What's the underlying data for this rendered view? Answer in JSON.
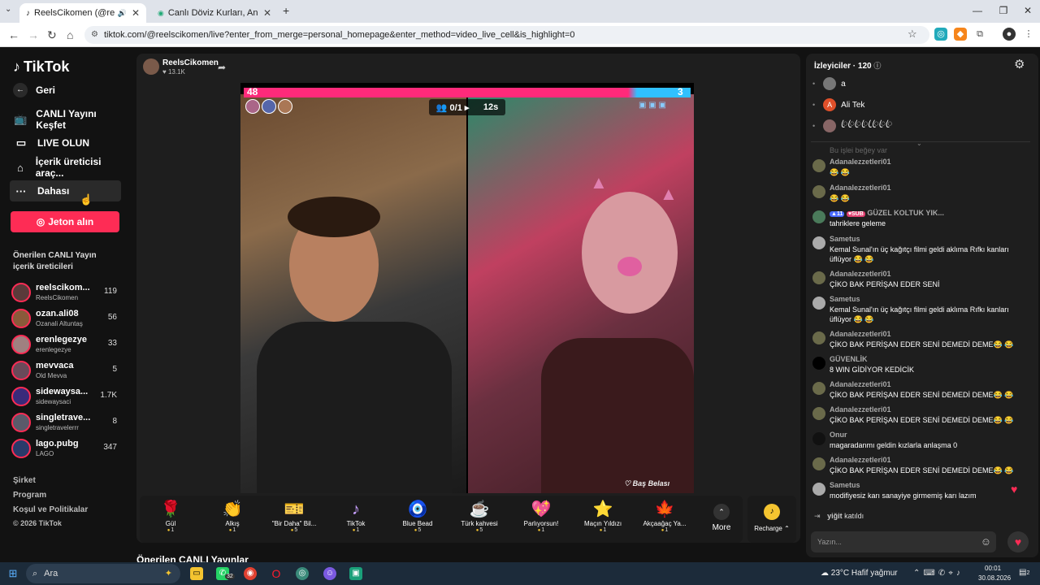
{
  "browser": {
    "tabs": [
      {
        "label": "ReelsCikomen (@reelscikom...",
        "active": true
      },
      {
        "label": "Canlı Döviz Kurları, Anlık Altın F...",
        "active": false
      }
    ],
    "url": "tiktok.com/@reelscikomen/live?enter_from_merge=personal_homepage&enter_method=video_live_cell&is_highlight=0"
  },
  "sidebar": {
    "logo": "TikTok",
    "back": "Geri",
    "nav": [
      {
        "label": "CANLI Yayını Keşfet",
        "icon": "live-tv-icon"
      },
      {
        "label": "LIVE OLUN",
        "icon": "camera-icon"
      },
      {
        "label": "İçerik üreticisi araç...",
        "icon": "home-tools-icon"
      },
      {
        "label": "Dahası",
        "icon": "more-icon"
      }
    ],
    "coins_button": "Jeton alın",
    "suggested_title": "Önerilen CANLI Yayın içerik üreticileri",
    "creators": [
      {
        "name": "reelscikom...",
        "sub": "ReelsCikomen",
        "count": "119"
      },
      {
        "name": "ozan.ali08",
        "sub": "Ozanali Altuntaş",
        "count": "56"
      },
      {
        "name": "erenlegezye",
        "sub": "erenlegezye",
        "count": "33"
      },
      {
        "name": "mevvaca",
        "sub": "Old Mevva",
        "count": "5"
      },
      {
        "name": "sidewaysa...",
        "sub": "sidewaysaci",
        "count": "1.7K"
      },
      {
        "name": "singletrave...",
        "sub": "singletravelerrr",
        "count": "8"
      },
      {
        "name": "lago.pubg",
        "sub": "LAGO",
        "count": "347"
      }
    ],
    "footer": [
      "Şirket",
      "Program",
      "Koşul ve Politikalar",
      "© 2026 TikTok"
    ]
  },
  "stream": {
    "host_name": "ReelsCikomen",
    "host_likes": "13.1K",
    "pk_left_score": "48",
    "pk_right_score": "3",
    "pk_count": "0/1",
    "pk_timer": "12s",
    "watermark": "Baş Belası",
    "suggested_live": "Önerilen CANLI Yayınlar"
  },
  "gifts": [
    {
      "name": "Gül",
      "price": "1",
      "icon": "🌹"
    },
    {
      "name": "Alkış",
      "price": "1",
      "icon": "👏"
    },
    {
      "name": "\"Bir Daha\" Bil...",
      "price": "5",
      "icon": "🎫"
    },
    {
      "name": "TikTok",
      "price": "1",
      "icon": "♪"
    },
    {
      "name": "Blue Bead",
      "price": "5",
      "icon": "🧿"
    },
    {
      "name": "Türk kahvesi",
      "price": "5",
      "icon": "☕"
    },
    {
      "name": "Parlıyorsun!",
      "price": "1",
      "icon": "💖"
    },
    {
      "name": "Maçın Yıldızı",
      "price": "1",
      "icon": "⭐"
    },
    {
      "name": "Akçaağaç Ya...",
      "price": "1",
      "icon": "🍁"
    }
  ],
  "gifts_more": "More",
  "recharge": "Recharge",
  "chat": {
    "viewers_title": "İzleyiciler · 120",
    "viewers": [
      {
        "name": "a",
        "initial": ""
      },
      {
        "name": "Ali Tek",
        "initial": "A"
      },
      {
        "name": "ꦿꦿꦿꦿ ꦿꦿꦿꦿ",
        "initial": ""
      }
    ],
    "faded_line": "Bu işlei beğey var",
    "messages": [
      {
        "user": "Adanalezzetleri01",
        "text": "😂 😂"
      },
      {
        "user": "Adanalezzetleri01",
        "text": "😂 😂"
      },
      {
        "user": "GÜZEL KOLTUK YIK...",
        "badge1": "11",
        "badge2": "SUB",
        "text": "tahriklere geleme"
      },
      {
        "user": "Sametus",
        "text": "Kemal Sunal'ın üç kağıtçı filmi geldi aklıma Rıfkı kanları üflüyor 😂 😂"
      },
      {
        "user": "Adanalezzetleri01",
        "text": "ÇİKO BAK PERİŞAN EDER SENİ"
      },
      {
        "user": "Sametus",
        "text": "Kemal Sunal'ın üç kağıtçı filmi geldi aklıma Rıfkı kanları üflüyor 😂 😂"
      },
      {
        "user": "Adanalezzetleri01",
        "text": "ÇİKO BAK PERİŞAN EDER SENİ DEMEDİ DEME😂 😂"
      },
      {
        "user": "GÜVENLİK",
        "text": "8 WIN GİDİYOR KEDİCİK"
      },
      {
        "user": "Adanalezzetleri01",
        "text": "ÇİKO BAK PERİŞAN EDER SENİ DEMEDİ DEME😂 😂"
      },
      {
        "user": "Adanalezzetleri01",
        "text": "ÇİKO BAK PERİŞAN EDER SENİ DEMEDİ DEME😂 😂"
      },
      {
        "user": "Onur",
        "text": "magaradanmı geldin kızlarla anlaşma 0"
      },
      {
        "user": "Adanalezzetleri01",
        "text": "ÇİKO BAK PERİŞAN EDER SENİ DEMEDİ DEME😂 😂"
      },
      {
        "user": "Sametus",
        "text": "modifiyesiz karı sanayiye girmemiş karı lazım"
      }
    ],
    "joined_user": "yiğit",
    "joined_text": "katıldı",
    "input_placeholder": "Yazın..."
  },
  "taskbar": {
    "search": "Ara",
    "badge": "32",
    "weather": "23°C  Hafif yağmur",
    "time": "00:01",
    "date": "30.08.2026",
    "notif": "2"
  },
  "colors": {
    "accent": "#fe2c55",
    "pk_blue": "#30c0ff",
    "bg": "#121212"
  }
}
